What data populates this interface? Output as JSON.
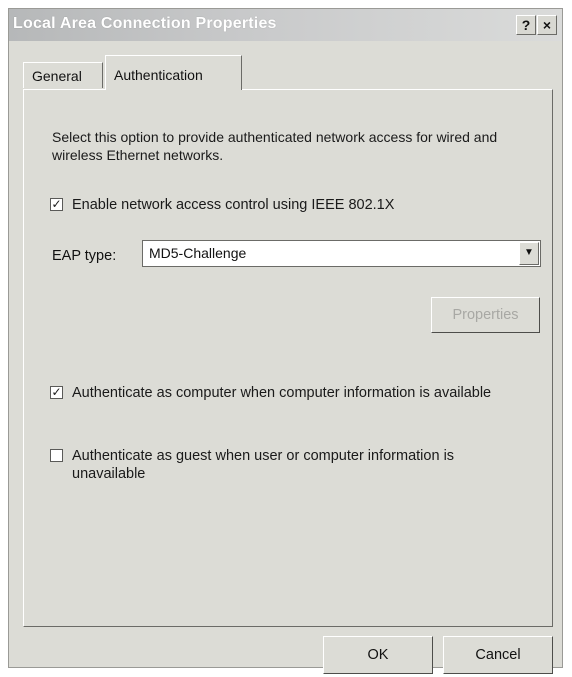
{
  "window": {
    "title": "Local Area Connection Properties",
    "help_button": "?",
    "close_button": "×"
  },
  "tabs": [
    {
      "label": "General",
      "selected": false
    },
    {
      "label": "Authentication",
      "selected": true
    }
  ],
  "authentication": {
    "description": "Select this option to provide authenticated network access for wired and wireless Ethernet networks.",
    "enable_8021x": {
      "label": "Enable network access control using IEEE 802.1X",
      "checked": true
    },
    "eap_type": {
      "label": "EAP type:",
      "value": "MD5-Challenge"
    },
    "properties_button": {
      "label": "Properties",
      "enabled": false
    },
    "auth_as_computer": {
      "label": "Authenticate as computer when computer information is available",
      "checked": true
    },
    "auth_as_guest": {
      "label": "Authenticate as guest when user or computer information is unavailable",
      "checked": false
    }
  },
  "footer": {
    "ok_label": "OK",
    "cancel_label": "Cancel"
  },
  "colors": {
    "dialog_bg": "#dcdcd6",
    "titlebar_bg": "#c9cacb",
    "disabled_text": "#a8a8a4"
  }
}
